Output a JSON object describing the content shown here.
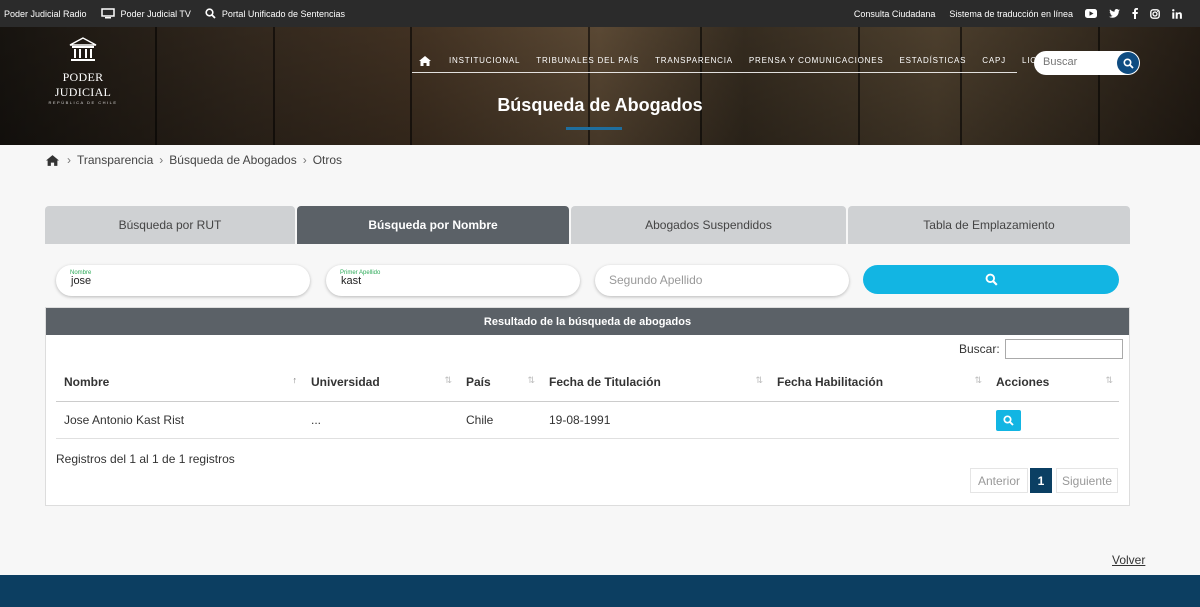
{
  "topbar": {
    "radio": "Poder Judicial Radio",
    "tv": "Poder Judicial TV",
    "portal": "Portal Unificado de Sentencias",
    "consulta": "Consulta Ciudadana",
    "traduccion": "Sistema de traducción en línea"
  },
  "logo": {
    "name": "PODER JUDICIAL",
    "sub": "REPÚBLICA DE CHILE"
  },
  "nav": {
    "items": [
      "INSTITUCIONAL",
      "TRIBUNALES DEL PAÍS",
      "TRANSPARENCIA",
      "PRENSA Y COMUNICACIONES",
      "ESTADÍSTICAS",
      "CAPJ",
      "LICITACIONES"
    ]
  },
  "header_search": {
    "placeholder": "Buscar"
  },
  "page_title": "Búsqueda de Abogados",
  "breadcrumb": [
    "Transparencia",
    "Búsqueda de Abogados",
    "Otros"
  ],
  "tabs": [
    "Búsqueda por RUT",
    "Búsqueda por Nombre",
    "Abogados Suspendidos",
    "Tabla de Emplazamiento"
  ],
  "form": {
    "nombre": {
      "label": "Nombre",
      "value": "jose"
    },
    "primer_apellido": {
      "label": "Primer Apellido",
      "value": "kast"
    },
    "segundo_apellido": {
      "placeholder": "Segundo Apellido"
    }
  },
  "results": {
    "title": "Resultado de la búsqueda de abogados",
    "filter_label": "Buscar:",
    "columns": [
      "Nombre",
      "Universidad",
      "País",
      "Fecha de Titulación",
      "Fecha Habilitación",
      "Acciones"
    ],
    "rows": [
      {
        "nombre": "Jose Antonio Kast Rist",
        "universidad": "...",
        "pais": "Chile",
        "fecha_titulacion": "19-08-1991",
        "fecha_habilitacion": ""
      }
    ],
    "info": "Registros del 1 al 1 de 1 registros",
    "pager": {
      "prev": "Anterior",
      "current": "1",
      "next": "Siguiente"
    }
  },
  "volver": "Volver",
  "colors": {
    "accent": "#12b5e3",
    "tab_active": "#5b6167",
    "navy": "#0c3e61"
  }
}
